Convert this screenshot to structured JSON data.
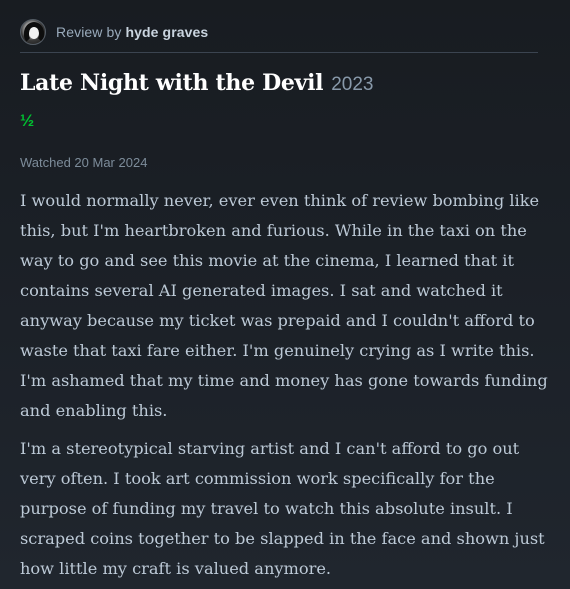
{
  "reviewer": {
    "prefix": "Review by",
    "name": "hyde graves"
  },
  "film": {
    "title": "Late Night with the Devil",
    "year": "2023"
  },
  "rating": "½",
  "watched": "Watched 20 Mar 2024",
  "review": {
    "paragraphs": [
      "I would normally never, ever even think of review bombing like this, but I'm heartbroken and furious. While in the taxi on the way to go and see this movie at the cinema, I learned that it contains several AI generated images. I sat and watched it anyway because my ticket was prepaid and I couldn't afford to waste that taxi fare either. I'm genuinely crying as I write this. I'm ashamed that my time and money has gone towards funding and enabling this.",
      "I'm a stereotypical starving artist and I can't afford to go out very often. I took art commission work specifically for the purpose of funding my travel to watch this absolute insult. I scraped coins together to be slapped in the face and shown just how little my craft is valued anymore."
    ]
  },
  "colors": {
    "background": "#1c2128",
    "rating_green": "#00c030",
    "text": "#bcc9d6"
  }
}
